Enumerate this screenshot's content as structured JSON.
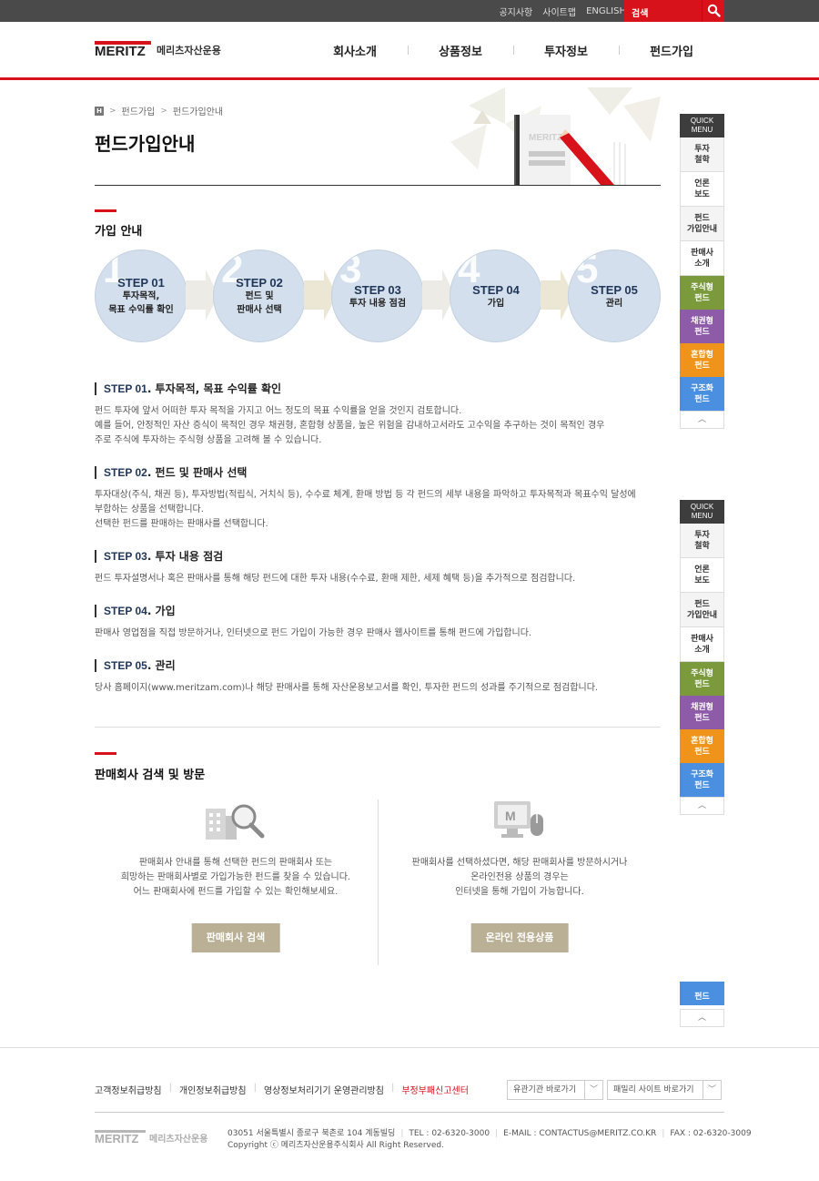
{
  "topbar": {
    "links": [
      "공지사항",
      "사이트맵",
      "ENGLISH"
    ],
    "search_label": "검색",
    "search_icon": "search-icon"
  },
  "header": {
    "logo_text": "MERITZ",
    "logo_kr": "메리츠자산운용",
    "nav": [
      "회사소개",
      "상품정보",
      "투자정보",
      "펀드가입"
    ]
  },
  "breadcrumb": [
    "펀드가입",
    "펀드가입안내"
  ],
  "page_title": "펀드가입안내",
  "banner": {
    "logo_text": "MERITZ"
  },
  "guide": {
    "title": "가입 안내",
    "steps": [
      {
        "num": "1",
        "label": "STEP 01",
        "desc1": "투자목적,",
        "desc2": "목표 수익률 확인"
      },
      {
        "num": "2",
        "label": "STEP 02",
        "desc1": "펀드 및",
        "desc2": "판매사 선택"
      },
      {
        "num": "3",
        "label": "STEP 03",
        "desc1": "투자 내용 점검",
        "desc2": ""
      },
      {
        "num": "4",
        "label": "STEP 04",
        "desc1": "가입",
        "desc2": ""
      },
      {
        "num": "5",
        "label": "STEP 05",
        "desc1": "관리",
        "desc2": ""
      }
    ]
  },
  "details": [
    {
      "num": "STEP 01",
      "title": ". 투자목적, 목표 수익률 확인",
      "lines": [
        "펀드 투자에 앞서 어떠한 투자 목적을 가지고 어느 정도의 목표 수익률을 얻을 것인지 검토합니다.",
        "예를 들어, 안정적인 자산 증식이 목적인 경우 채권형, 혼합형 상품을, 높은 위험을 감내하고서라도 고수익을 추구하는 것이 목적인 경우",
        "주로 주식에 투자하는 주식형 상품을 고려해 볼 수 있습니다."
      ]
    },
    {
      "num": "STEP 02",
      "title": ". 펀드 및 판매사 선택",
      "lines": [
        "투자대상(주식, 채권 등), 투자방법(적립식, 거치식 등), 수수료 체계, 환매 방법 등 각 펀드의 세부 내용을 파악하고 투자목적과 목표수익 달성에",
        "부합하는 상품을 선택합니다.",
        "선택한 펀드를 판매하는 판매사를 선택합니다."
      ]
    },
    {
      "num": "STEP 03",
      "title": ". 투자 내용 점검",
      "lines": [
        "펀드 투자설명서나 혹은 판매사를 통해 해당 펀드에 대한 투자 내용(수수료, 환매 제한, 세제 혜택 등)을 추가적으로 점검합니다."
      ]
    },
    {
      "num": "STEP 04",
      "title": ". 가입",
      "lines": [
        "판매사 영업점을 직접 방문하거나, 인터넷으로 펀드 가입이 가능한 경우 판매사 웹사이트를 통해 펀드에 가입합니다."
      ]
    },
    {
      "num": "STEP 05",
      "title": ". 관리",
      "lines": [
        "당사 홈페이지(www.meritzam.com)나 해당 판매사를 통해 자산운용보고서를 확인, 투자한 펀드의 성과를 주기적으로 점검합니다."
      ]
    }
  ],
  "sales": {
    "title": "판매회사 검색 및 방문",
    "left": {
      "lines": [
        "판매회사 안내를 통해 선택한 펀드의 판매회사 또는",
        "희망하는 판매회사별로 가입가능한 펀드를 찾을 수 있습니다.",
        "어느 판매회사에 펀드를 가입할 수 있는 확인해보세요."
      ],
      "button": "판매회사 검색"
    },
    "right": {
      "lines": [
        "판매회사를 선택하셨다면, 해당 판매회사를 방문하시거나",
        "온라인전용 상품의 경우는",
        "인터넷을 통해 가입이 가능합니다."
      ],
      "button": "온라인 전용상품"
    }
  },
  "quick_menu": {
    "head1": "QUICK",
    "head2": "MENU",
    "items": [
      {
        "l1": "투자",
        "l2": "철학"
      },
      {
        "l1": "언론",
        "l2": "보도"
      },
      {
        "l1": "펀드",
        "l2": "가입안내"
      },
      {
        "l1": "판매사",
        "l2": "소개"
      }
    ],
    "funds": [
      {
        "l1": "주식형",
        "l2": "펀드",
        "color": "#7a9a3c"
      },
      {
        "l1": "채권형",
        "l2": "펀드",
        "color": "#8e5ba8"
      },
      {
        "l1": "혼합형",
        "l2": "펀드",
        "color": "#f0931a"
      },
      {
        "l1": "구조화",
        "l2": "펀드",
        "color": "#4a8fe0"
      }
    ],
    "top": "︿",
    "partial_fund": "구조화",
    "partial_fund_l2": "펀드"
  },
  "footer": {
    "links": [
      "고객정보취급방침",
      "개인정보취급방침",
      "영상정보처리기기 운영관리방침",
      "부정부패신고센터"
    ],
    "select1": "유관기관 바로가기",
    "select2": "패밀리 사이트 바로가기",
    "logo_text": "MERITZ",
    "logo_kr": "메리츠자산운용",
    "address": "03051 서울특별시 종로구 북촌로 104 계동빌딩",
    "tel": "TEL : 02-6320-3000",
    "email": "E-MAIL : CONTACTUS@MERITZ.CO.KR",
    "fax": "FAX : 02-6320-3009",
    "copyright": "Copyright ⓒ 메리츠자산운용주식회사 All Right Reserved."
  }
}
